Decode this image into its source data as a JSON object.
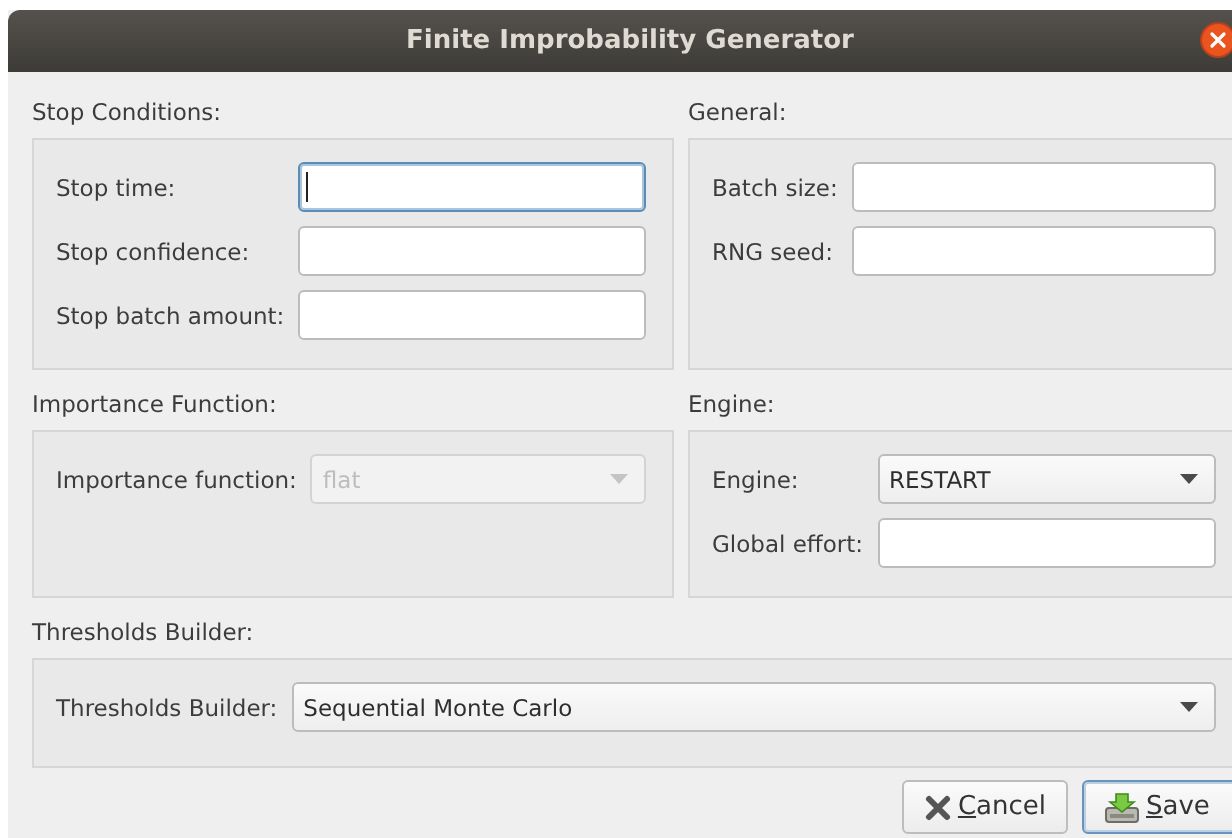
{
  "window": {
    "title": "Finite Improbability Generator"
  },
  "sections": [
    {
      "title": "Stop Conditions:",
      "wide": false,
      "fields": [
        {
          "kind": "text",
          "label": "Stop time:",
          "focused": true
        },
        {
          "kind": "text",
          "label": "Stop confidence:",
          "focused": false
        },
        {
          "kind": "text",
          "label": "Stop batch amount:",
          "focused": false
        }
      ]
    },
    {
      "title": "General:",
      "wide": false,
      "fields": [
        {
          "kind": "text",
          "label": "Batch size:",
          "focused": false
        },
        {
          "kind": "text",
          "label": "RNG seed:",
          "focused": false
        }
      ]
    },
    {
      "title": "Importance Function:",
      "wide": false,
      "fields": [
        {
          "kind": "combo",
          "label": "Importance function:",
          "value": "flat",
          "disabled": true
        }
      ]
    },
    {
      "title": "Engine:",
      "wide": false,
      "fields": [
        {
          "kind": "combo",
          "label": "Engine:",
          "value": "RESTART",
          "disabled": false
        },
        {
          "kind": "text",
          "label": "Global effort:",
          "focused": false
        }
      ]
    },
    {
      "title": "Thresholds Builder:",
      "wide": true,
      "fields": [
        {
          "kind": "combo",
          "label": "Thresholds Builder:",
          "value": "Sequential Monte Carlo",
          "disabled": false
        }
      ]
    }
  ],
  "buttons": [
    {
      "label": "Cancel",
      "kind": "cancel",
      "default": false,
      "mnemonic_underlined": true
    },
    {
      "label": "Save",
      "kind": "save",
      "default": true,
      "mnemonic_underlined": true
    }
  ]
}
